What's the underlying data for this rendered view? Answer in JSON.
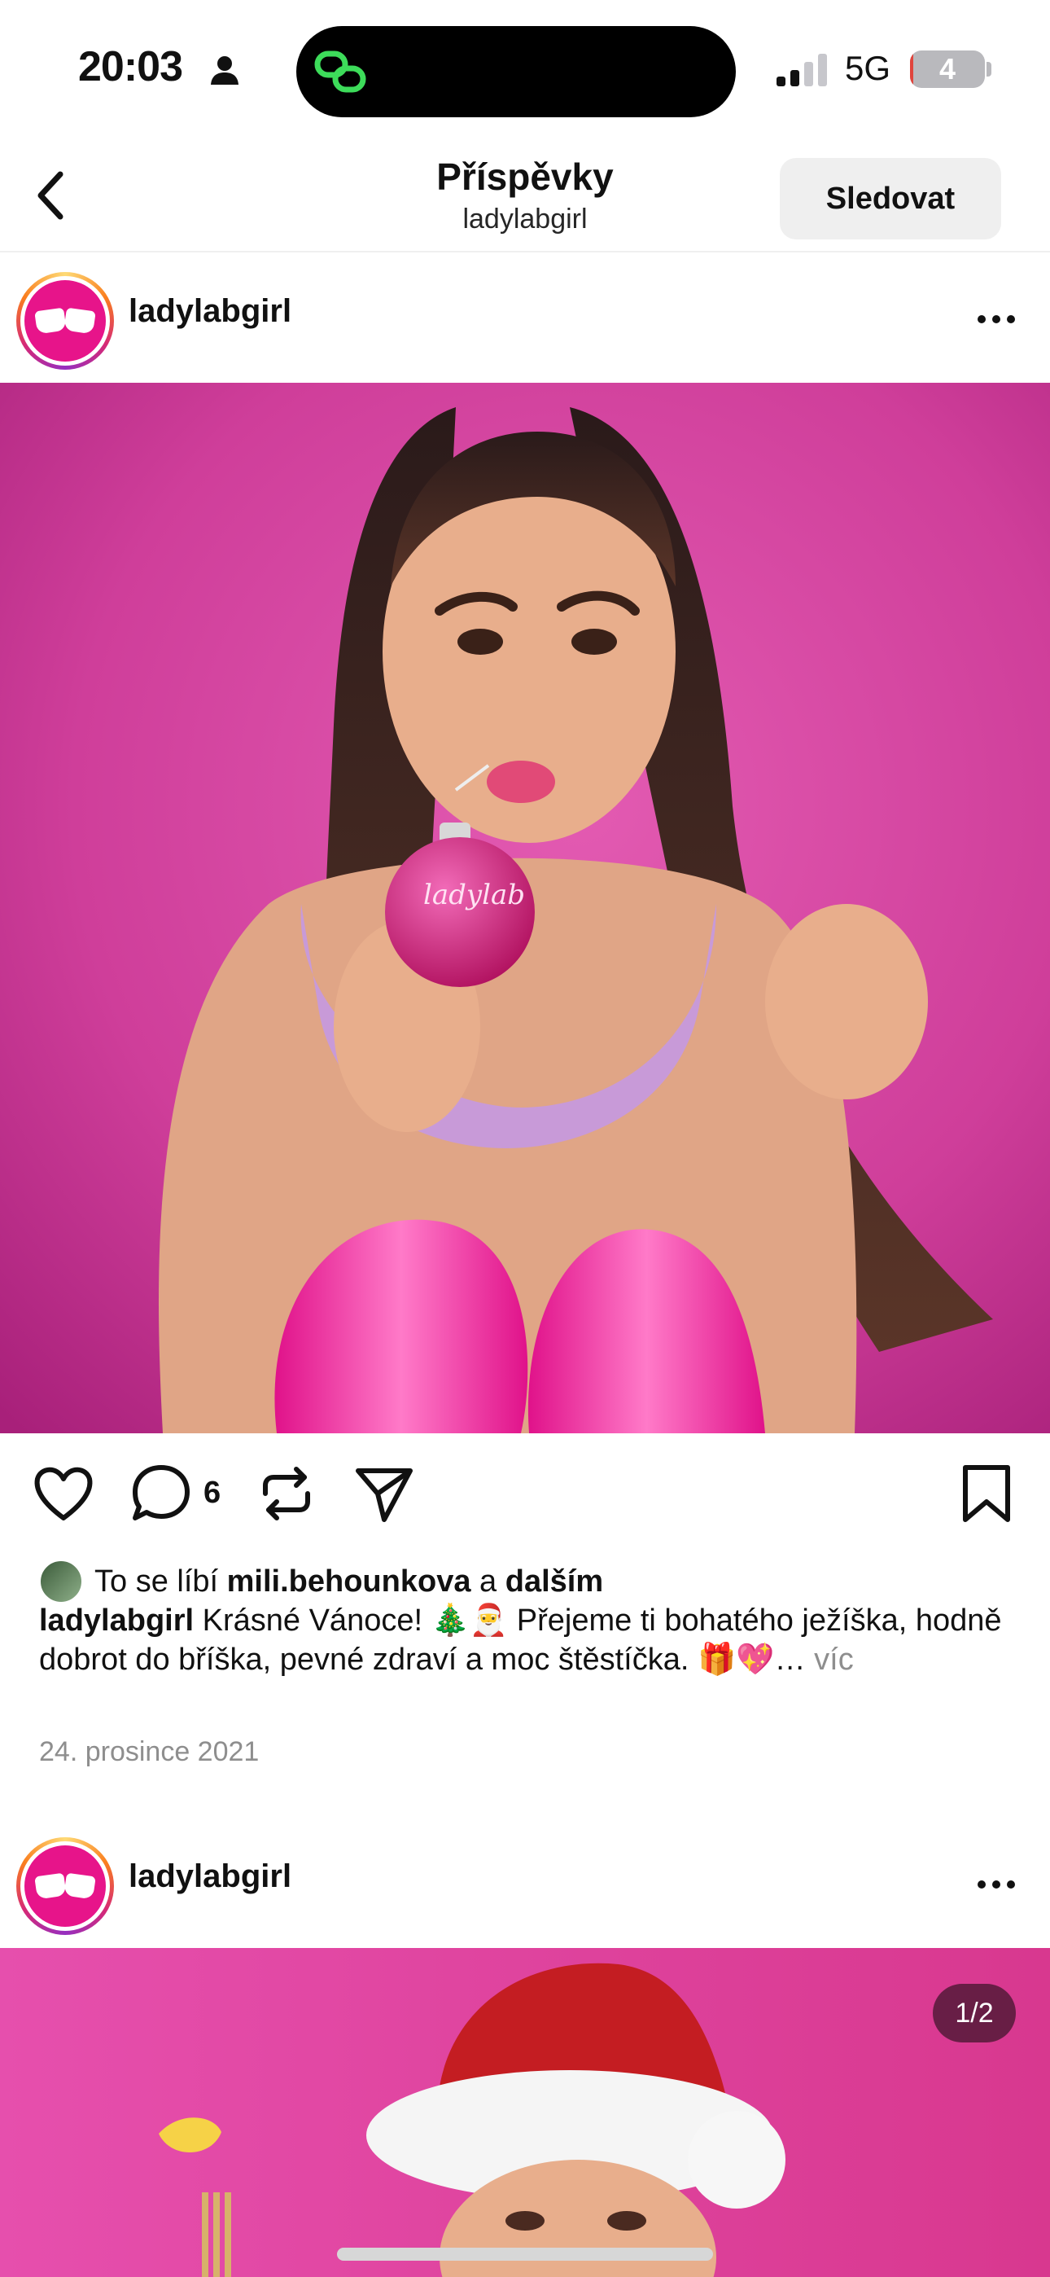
{
  "status_bar": {
    "time": "20:03",
    "network": "5G",
    "battery_level": "4",
    "battery_percent": 4,
    "icons": [
      "person-icon",
      "chain-link-icon",
      "signal-icon",
      "battery-icon"
    ]
  },
  "header": {
    "title": "Příspěvky",
    "subtitle": "ladylabgirl",
    "follow_label": "Sledovat",
    "back_icon": "chevron-left-icon"
  },
  "post1": {
    "username": "ladylabgirl",
    "comment_count": "6",
    "likes": {
      "prefix": "To se líbí",
      "user": "mili.behounkova",
      "joiner": "a",
      "others": "dalším"
    },
    "caption_user": "ladylabgirl",
    "caption_text": "Krásné Vánoce! 🎄🎅 Přejeme ti bohatého ježíška, hodně dobrot do bříška, pevné zdraví a moc štěstíčka. 🎁💖…",
    "more_label": "víc",
    "date": "24. prosince 2021",
    "ornament_text": "ladylab"
  },
  "post2": {
    "username": "ladylabgirl",
    "image_counter": "1/2"
  },
  "colors": {
    "brand_pink": "#e7148a",
    "background_pink": "#d9479f",
    "battery_low": "#e0453d",
    "secondary_text": "#8e8e8e"
  }
}
